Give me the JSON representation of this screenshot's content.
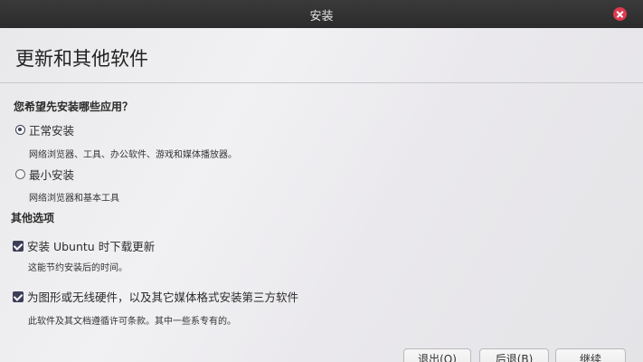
{
  "window": {
    "title": "安装"
  },
  "header": {
    "page_title": "更新和其他软件"
  },
  "apps": {
    "question": "您希望先安装哪些应用？",
    "options": [
      {
        "label": "正常安装",
        "description": "网络浏览器、工具、办公软件、游戏和媒体播放器。",
        "selected": true
      },
      {
        "label": "最小安装",
        "description": "网络浏览器和基本工具",
        "selected": false
      }
    ]
  },
  "other_options": {
    "heading": "其他选项",
    "items": [
      {
        "label": "安装 Ubuntu 时下载更新",
        "description": "这能节约安装后的时间。",
        "checked": true
      },
      {
        "label": "为图形或无线硬件，以及其它媒体格式安装第三方软件",
        "description": "此软件及其文档遵循许可条款。其中一些系专有的。",
        "checked": true
      }
    ]
  },
  "buttons": {
    "quit": "退出(Q)",
    "back": "后退(B)",
    "continue": "继续"
  },
  "colors": {
    "titlebar": "#2b2b2b",
    "close": "#e0394f",
    "checkbox": "#3d3f5a"
  }
}
